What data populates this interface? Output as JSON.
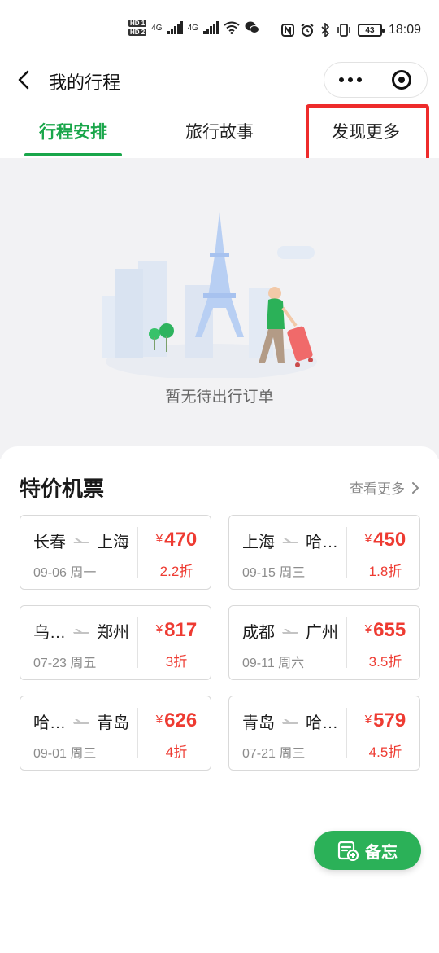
{
  "status_bar": {
    "sim1": "HD 1",
    "sim2": "HD 2",
    "net1": "4G",
    "net2": "4G",
    "battery": "43",
    "time": "18:09"
  },
  "header": {
    "title": "我的行程"
  },
  "tabs": [
    {
      "label": "行程安排",
      "active": true
    },
    {
      "label": "旅行故事",
      "active": false
    },
    {
      "label": "发现更多",
      "active": false
    }
  ],
  "empty_state": {
    "message": "暂无待出行订单"
  },
  "deals": {
    "title": "特价机票",
    "see_more": "查看更多",
    "tickets": [
      {
        "from": "长春",
        "to": "上海",
        "date": "09-06 周一",
        "currency": "¥",
        "price": "470",
        "discount": "2.2折"
      },
      {
        "from": "上海",
        "to": "哈…",
        "date": "09-15 周三",
        "currency": "¥",
        "price": "450",
        "discount": "1.8折"
      },
      {
        "from": "乌…",
        "to": "郑州",
        "date": "07-23 周五",
        "currency": "¥",
        "price": "817",
        "discount": "3折"
      },
      {
        "from": "成都",
        "to": "广州",
        "date": "09-11 周六",
        "currency": "¥",
        "price": "655",
        "discount": "3.5折"
      },
      {
        "from": "哈…",
        "to": "青岛",
        "date": "09-01 周三",
        "currency": "¥",
        "price": "626",
        "discount": "4折"
      },
      {
        "from": "青岛",
        "to": "哈…",
        "date": "07-21 周三",
        "currency": "¥",
        "price": "579",
        "discount": "4.5折"
      }
    ]
  },
  "memo_button": {
    "label": "备忘"
  },
  "colors": {
    "accent_green": "#19a64a",
    "price_red": "#ee3b32",
    "highlight_red": "#ee2b2b",
    "memo_green": "#2bb158"
  }
}
